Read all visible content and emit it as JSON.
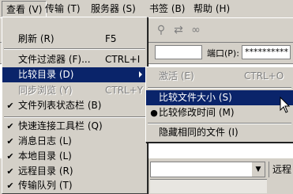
{
  "menubar": {
    "items": [
      {
        "label": "查看 (V)"
      },
      {
        "label": "传输 (T)"
      },
      {
        "label": "服务器 (S)"
      },
      {
        "label": "书签 (B)"
      },
      {
        "label": "帮助 (H)"
      }
    ]
  },
  "quickconnect": {
    "port_label": "端口(P):",
    "field_value": "**********"
  },
  "lower": {
    "remote_label": "远程"
  },
  "view_menu": {
    "items": [
      {
        "label": "刷新 (R)",
        "shortcut": "F5"
      },
      {
        "label": "文件过滤器 (F)...",
        "shortcut": "CTRL+I"
      },
      {
        "label": "比较目录 (D)",
        "shortcut": ""
      },
      {
        "label": "同步浏览 (Y)",
        "shortcut": "CTRL+Y"
      },
      {
        "label": "文件列表状态栏 (B)",
        "shortcut": "",
        "check": "✔"
      },
      {
        "label": "快速连接工具栏 (Q)",
        "shortcut": "",
        "check": "✔"
      },
      {
        "label": "消息日志 (L)",
        "shortcut": "",
        "check": "✔"
      },
      {
        "label": "本地目录 (L)",
        "shortcut": "",
        "check": "✔"
      },
      {
        "label": "远程目录 (R)",
        "shortcut": "",
        "check": "✔"
      },
      {
        "label": "传输队列 (T)",
        "shortcut": "",
        "check": "✔"
      }
    ]
  },
  "compare_submenu": {
    "items": [
      {
        "label": "激活 (E)",
        "shortcut": "CTRL+O"
      },
      {
        "label": "比较文件大小 (S)",
        "shortcut": ""
      },
      {
        "label": "比较修改时间 (M)",
        "shortcut": "",
        "check": "●"
      },
      {
        "label": "隐藏相同的文件 (I)",
        "shortcut": ""
      }
    ]
  },
  "colors": {
    "menu_face": "#d4d0c8",
    "highlight": "#0a246a",
    "highlight_text": "#ffffff",
    "disabled_text": "#808080"
  }
}
